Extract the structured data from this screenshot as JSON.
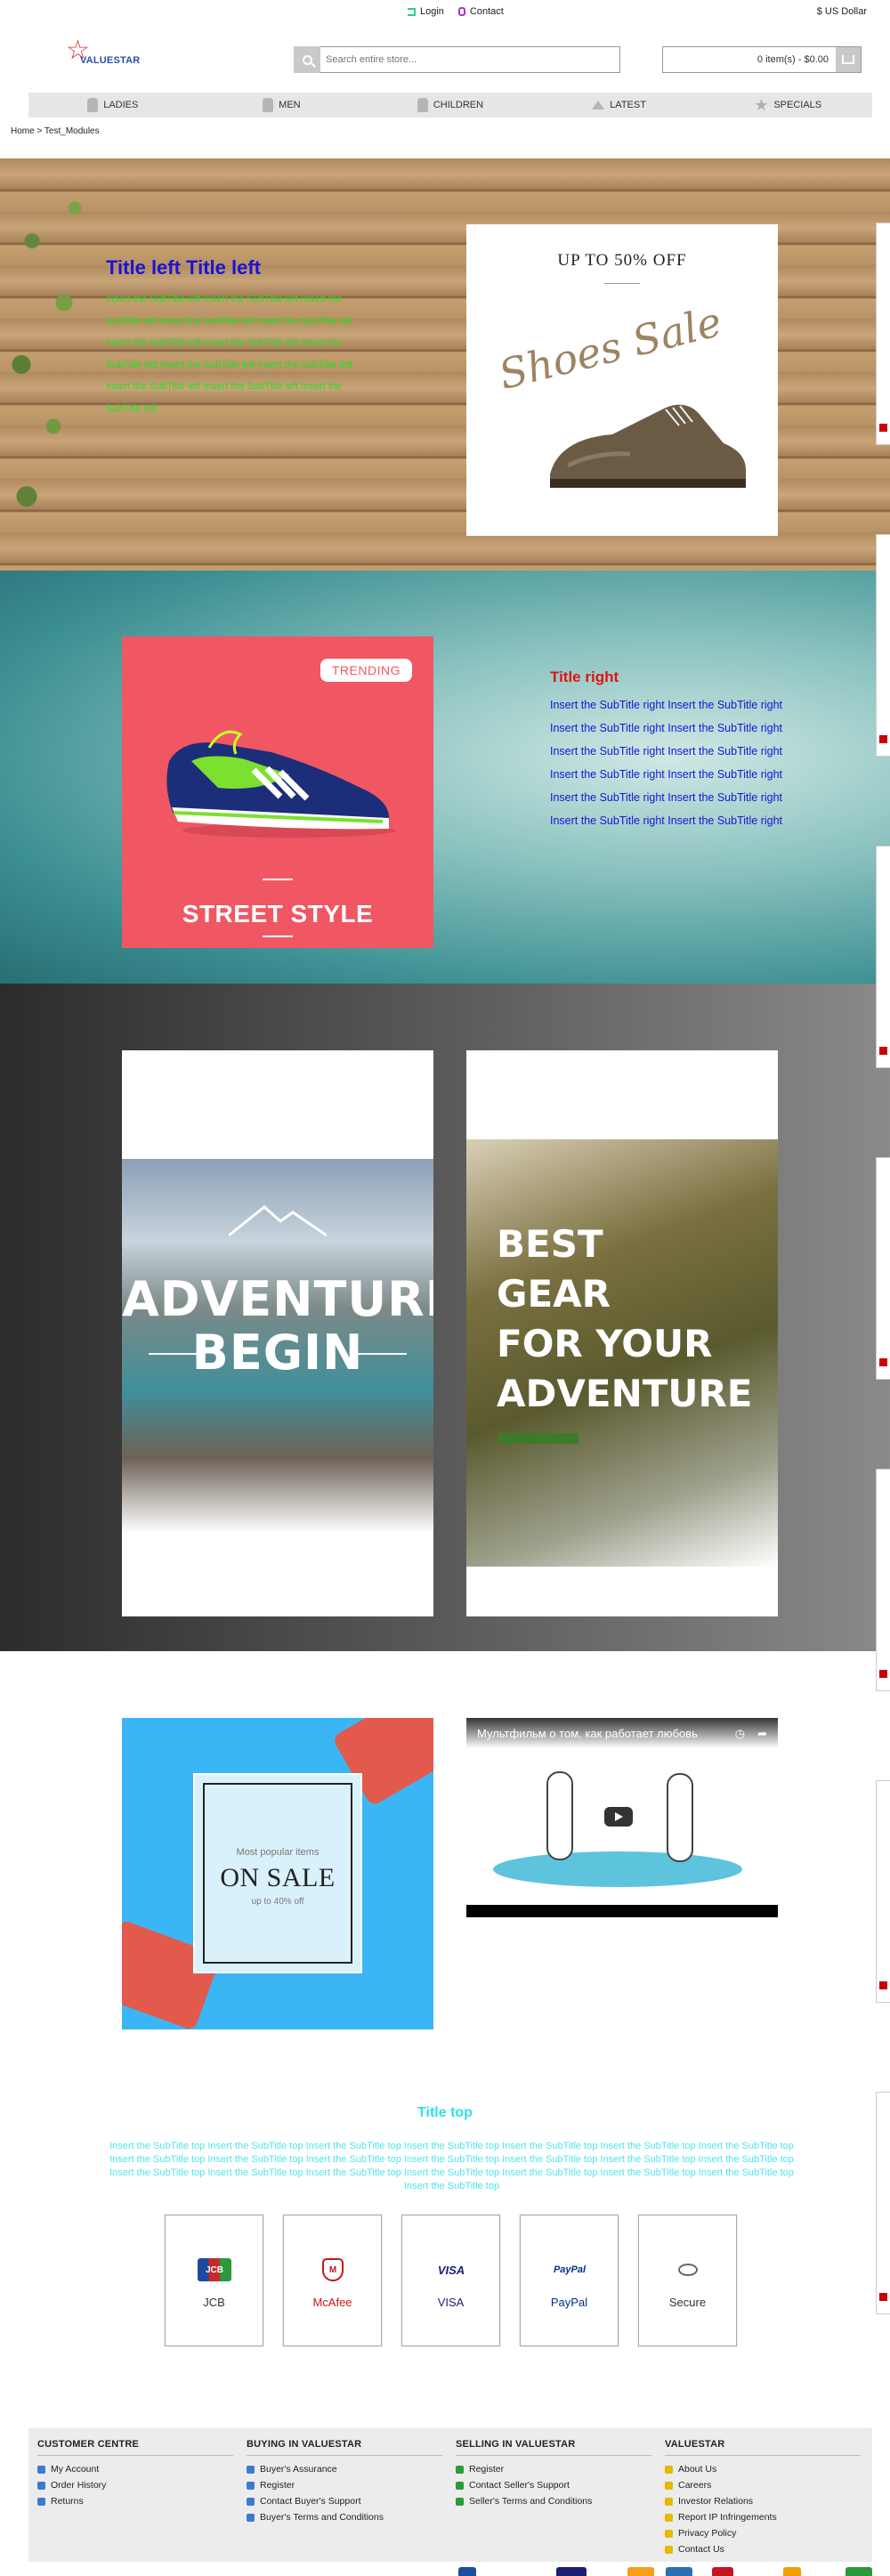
{
  "topbar": {
    "login": "Login",
    "contact": "Contact",
    "currency": "$ US Dollar"
  },
  "header": {
    "logo_text": "VALUESTAR",
    "search_placeholder": "Search entire store...",
    "cart_text": "0 item(s) - $0.00"
  },
  "nav": [
    {
      "label": "LADIES",
      "icon": "dress-icon"
    },
    {
      "label": "MEN",
      "icon": "man-icon"
    },
    {
      "label": "CHILDREN",
      "icon": "child-icon"
    },
    {
      "label": "LATEST",
      "icon": "arrow-up-icon"
    },
    {
      "label": "SPECIALS",
      "icon": "star-icon"
    }
  ],
  "breadcrumb": {
    "home": "Home",
    "sep": ">",
    "current": "Test_Modules"
  },
  "section1": {
    "title": "Title left Title left",
    "text": "Insert the SubTitle left Insert the SubTitle left Insert the SubTitle left Insert the SubTitle left Insert the SubTitle left Insert the SubTitle left Insert the SubTitle left Insert the SubTitle left Insert the SubTitle left Insert the SubTitle left Insert the SubTitle left Insert the SubTitle left Insert the SubTitle left",
    "banner_top": "UP TO 50% OFF",
    "banner_script": "Shoes Sale",
    "title_color": "#1a14d6",
    "text_color": "#23e023"
  },
  "section2": {
    "badge": "TRENDING",
    "banner_caption": "STREET STYLE",
    "title": "Title right",
    "text": "Insert the SubTitle right Insert the SubTitle right Insert the SubTitle right Insert the SubTitle right Insert the SubTitle right Insert the SubTitle right Insert the SubTitle right Insert the SubTitle right Insert the SubTitle right Insert the SubTitle right Insert the SubTitle right Insert the SubTitle right",
    "title_color": "#e01414",
    "text_color": "#1a14d6"
  },
  "section3": {
    "left_banner": "ADVENTURES BEGIN",
    "right_banner_lines": [
      "BEST",
      "GEAR",
      "FOR YOUR",
      "ADVENTURE"
    ]
  },
  "section4": {
    "sale_small": "Most popular items",
    "sale_big": "ON SALE",
    "sale_sub": "up to 40% off",
    "video_title": "Мультфильм о том, как работает любовь"
  },
  "section5": {
    "title": "Title top",
    "text": "Insert the SubTitle top Insert the SubTitle top Insert the SubTitle top Insert the SubTitle top Insert the SubTitle top Insert the SubTitle top Insert the SubTitle top Insert the SubTitle top Insert the SubTitle top Insert the SubTitle top Insert the SubTitle top Insert the SubTitle top Insert the SubTitle top Insert the SubTitle top Insert the SubTitle top Insert the SubTitle top Insert the SubTitle top Insert the SubTitle top Insert the SubTitle top Insert the SubTitle top Insert the SubTitle top Insert the SubTitle top",
    "payments": [
      {
        "label": "JCB",
        "logo": "JCB",
        "color": "#333"
      },
      {
        "label": "McAfee",
        "logo": "M",
        "color": "#c4161c"
      },
      {
        "label": "VISA",
        "logo": "VISA",
        "color": "#1a1f71"
      },
      {
        "label": "PayPal",
        "logo": "PayPal",
        "color": "#003087"
      },
      {
        "label": "Secure",
        "logo": "",
        "color": "#333"
      }
    ]
  },
  "footer": {
    "columns": [
      {
        "heading": "CUSTOMER CENTRE",
        "items": [
          "My Account",
          "Order History",
          "Returns"
        ]
      },
      {
        "heading": "BUYING IN VALUESTAR",
        "items": [
          "Buyer's Assurance",
          "Register",
          "Contact Buyer's Support",
          "Buyer's Terms and Conditions"
        ]
      },
      {
        "heading": "SELLING IN VALUESTAR",
        "items": [
          "Register",
          "Contact Seller's Support",
          "Seller's Terms and Conditions"
        ]
      },
      {
        "heading": "VALUESTAR",
        "items": [
          "About Us",
          "Careers",
          "Investor Relations",
          "Report IP Infringements",
          "Privacy Policy",
          "Contact Us"
        ]
      }
    ]
  },
  "colors": {
    "accent_blue": "#1a14d6",
    "accent_green": "#23e023",
    "accent_red": "#e01414",
    "accent_cyan": "#2ee0e8",
    "nav_bg": "#e6e6e6"
  }
}
